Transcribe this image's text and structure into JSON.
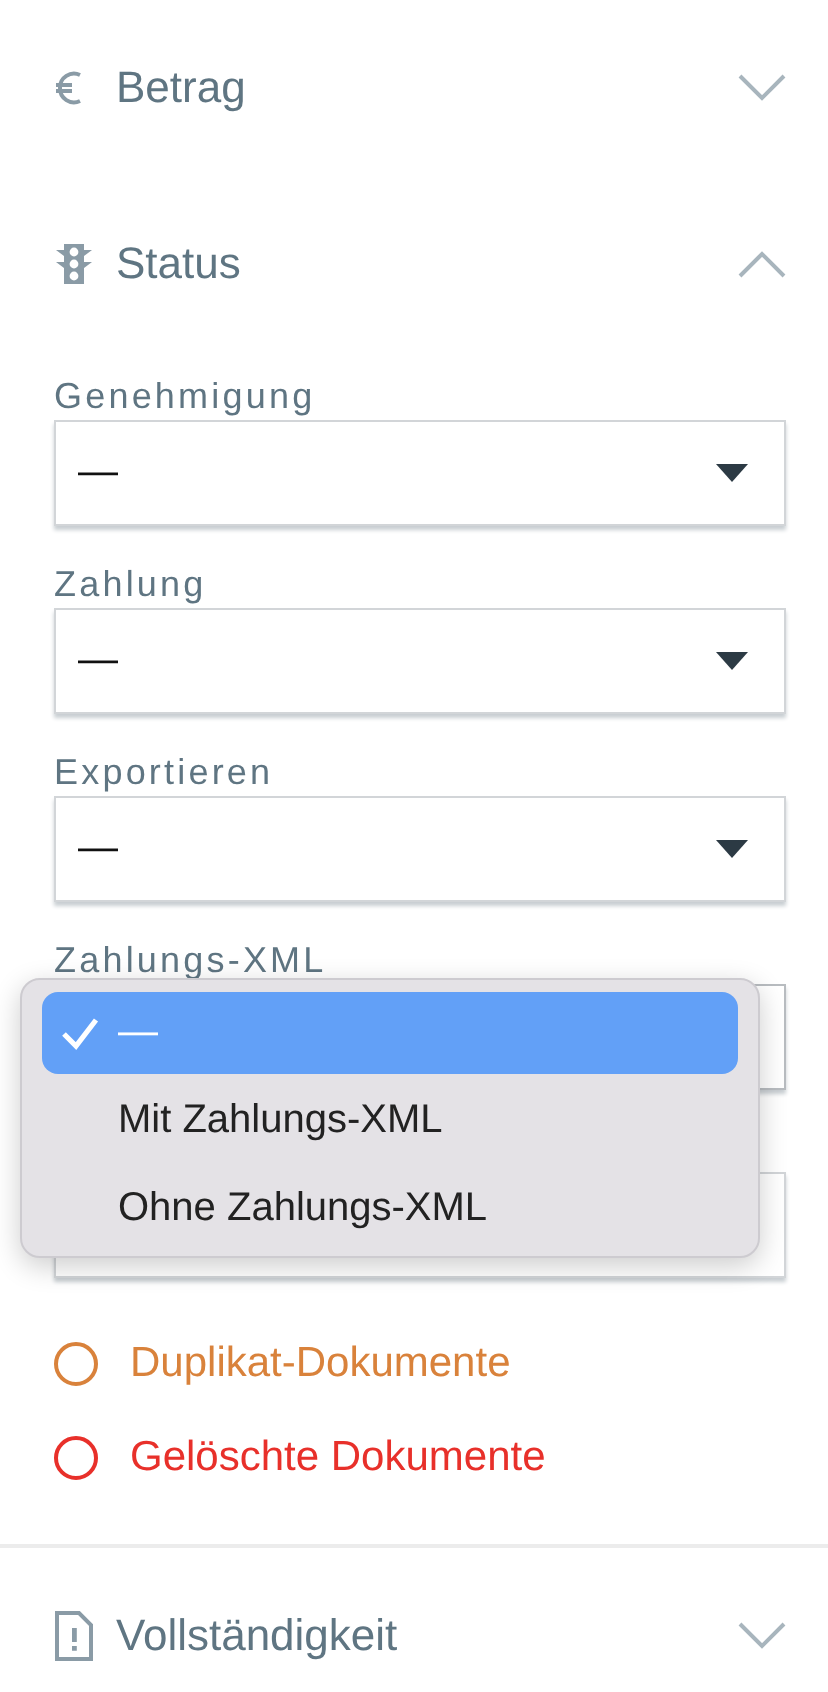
{
  "sections": [
    {
      "kind": "euro",
      "title": "Betrag",
      "expanded": false
    },
    {
      "kind": "traffic",
      "title": "Status",
      "expanded": true,
      "selects": [
        {
          "label": "Genehmigung",
          "value": "—",
          "open": false
        },
        {
          "label": "Zahlung",
          "value": "—",
          "open": false
        },
        {
          "label": "Exportieren",
          "value": "—",
          "open": false
        },
        {
          "label": "Zahlungs-XML",
          "open": true
        },
        {
          "open": false
        }
      ],
      "options": [
        {
          "label": "Duplikat-Dokumente",
          "checked": false,
          "color": "#d9823b"
        },
        {
          "label": "Gelöschte Dokumente",
          "checked": false,
          "color": "#e8302a"
        }
      ]
    },
    {
      "kind": "document",
      "title": "Vollständigkeit",
      "expanded": false
    }
  ],
  "dropdown_menu": [
    {
      "label": "—",
      "selected": true
    },
    {
      "label": "Mit Zahlungs-XML",
      "selected": false
    },
    {
      "label": "Ohne Zahlungs-XML",
      "selected": false
    }
  ]
}
